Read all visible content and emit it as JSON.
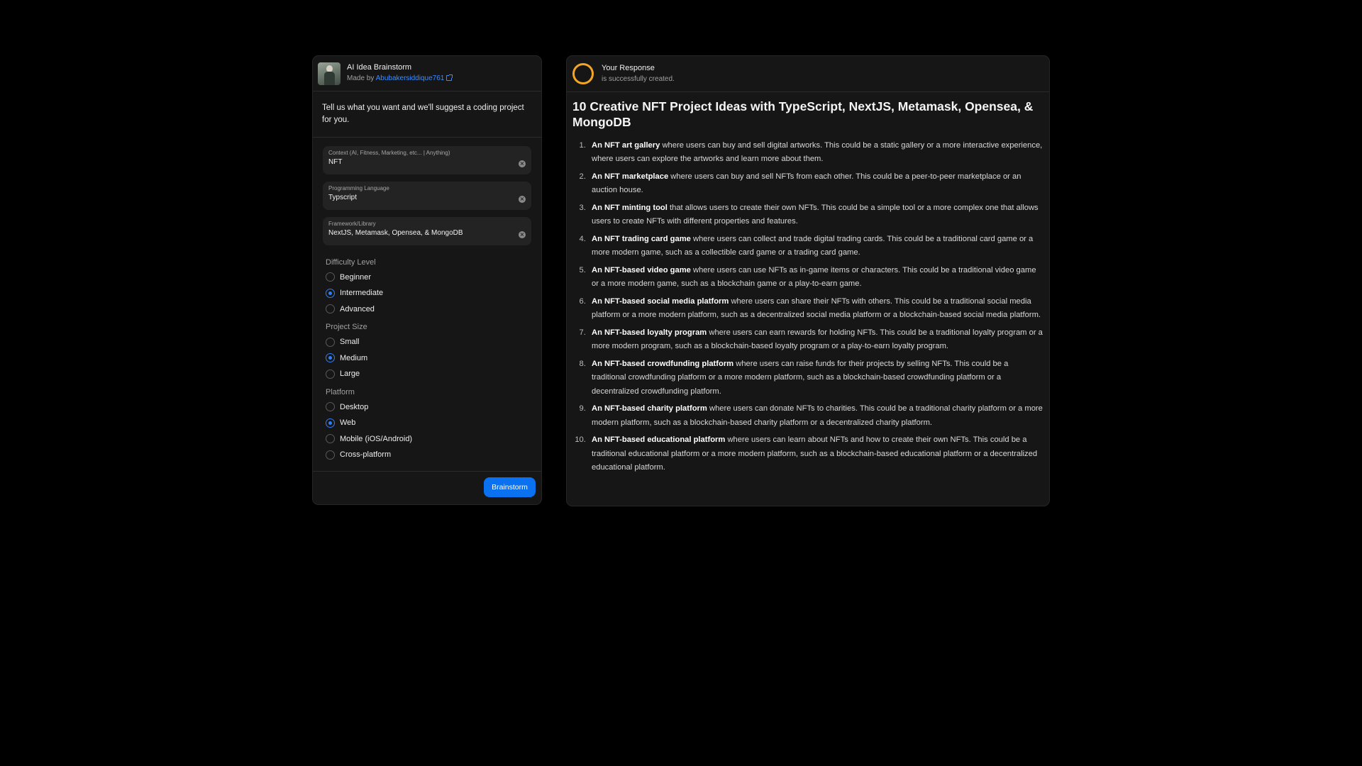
{
  "app": {
    "title": "AI Idea Brainstorm",
    "made_by_prefix": "Made by",
    "author": "Abubakersiddique761",
    "intro": "Tell us what you want and we'll suggest a coding project for you."
  },
  "form": {
    "fields": [
      {
        "label": "Context (AI, Fitness, Marketing, etc... | Anything)",
        "value": "NFT"
      },
      {
        "label": "Programming Language",
        "value": "Typscript"
      },
      {
        "label": "Framework/Library",
        "value": "NextJS, Metamask, Opensea, & MongoDB"
      }
    ],
    "groups": [
      {
        "title": "Difficulty Level",
        "options": [
          {
            "label": "Beginner",
            "selected": false
          },
          {
            "label": "Intermediate",
            "selected": true
          },
          {
            "label": "Advanced",
            "selected": false
          }
        ]
      },
      {
        "title": "Project Size",
        "options": [
          {
            "label": "Small",
            "selected": false
          },
          {
            "label": "Medium",
            "selected": true
          },
          {
            "label": "Large",
            "selected": false
          }
        ]
      },
      {
        "title": "Platform",
        "options": [
          {
            "label": "Desktop",
            "selected": false
          },
          {
            "label": "Web",
            "selected": true
          },
          {
            "label": "Mobile (iOS/Android)",
            "selected": false
          },
          {
            "label": "Cross-platform",
            "selected": false
          }
        ]
      }
    ],
    "submit_label": "Brainstorm"
  },
  "response": {
    "title": "Your Response",
    "subtitle": "is successfully created.",
    "heading": "10 Creative NFT Project Ideas with TypeScript, NextJS, Metamask, Opensea, & MongoDB",
    "ideas": [
      {
        "bold": "An NFT art gallery",
        "text": " where users can buy and sell digital artworks. This could be a static gallery or a more interactive experience, where users can explore the artworks and learn more about them."
      },
      {
        "bold": "An NFT marketplace",
        "text": " where users can buy and sell NFTs from each other. This could be a peer-to-peer marketplace or an auction house."
      },
      {
        "bold": "An NFT minting tool",
        "text": " that allows users to create their own NFTs. This could be a simple tool or a more complex one that allows users to create NFTs with different properties and features."
      },
      {
        "bold": "An NFT trading card game",
        "text": " where users can collect and trade digital trading cards. This could be a traditional card game or a more modern game, such as a collectible card game or a trading card game."
      },
      {
        "bold": "An NFT-based video game",
        "text": " where users can use NFTs as in-game items or characters. This could be a traditional video game or a more modern game, such as a blockchain game or a play-to-earn game."
      },
      {
        "bold": "An NFT-based social media platform",
        "text": " where users can share their NFTs with others. This could be a traditional social media platform or a more modern platform, such as a decentralized social media platform or a blockchain-based social media platform."
      },
      {
        "bold": "An NFT-based loyalty program",
        "text": " where users can earn rewards for holding NFTs. This could be a traditional loyalty program or a more modern program, such as a blockchain-based loyalty program or a play-to-earn loyalty program."
      },
      {
        "bold": "An NFT-based crowdfunding platform",
        "text": " where users can raise funds for their projects by selling NFTs. This could be a traditional crowdfunding platform or a more modern platform, such as a blockchain-based crowdfunding platform or a decentralized crowdfunding platform."
      },
      {
        "bold": "An NFT-based charity platform",
        "text": " where users can donate NFTs to charities. This could be a traditional charity platform or a more modern platform, such as a blockchain-based charity platform or a decentralized charity platform."
      },
      {
        "bold": "An NFT-based educational platform",
        "text": " where users can learn about NFTs and how to create their own NFTs. This could be a traditional educational platform or a more modern platform, such as a blockchain-based educational platform or a decentralized educational platform."
      }
    ]
  },
  "colors": {
    "accent": "#0a72f0",
    "radio_selected": "#2f7df6",
    "status_ring": "#f5a524",
    "link": "#3b8cff"
  }
}
